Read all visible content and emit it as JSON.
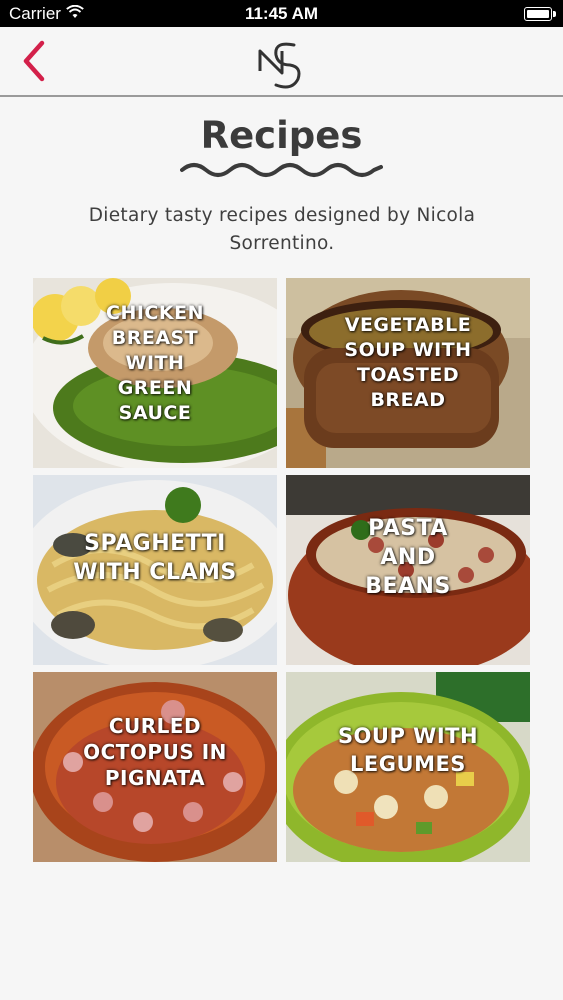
{
  "status_bar": {
    "carrier": "Carrier",
    "time": "11:45 AM"
  },
  "page": {
    "title": "Recipes",
    "subtitle": "Dietary tasty recipes designed by Nicola Sorrentino."
  },
  "recipes": [
    {
      "name": "CHICKEN BREAST WITH GREEN SAUCE"
    },
    {
      "name": "VEGETABLE SOUP WITH TOASTED BREAD"
    },
    {
      "name": "SPAGHETTI WITH CLAMS"
    },
    {
      "name": "PASTA AND BEANS"
    },
    {
      "name": "CURLED OCTOPUS IN PIGNATA"
    },
    {
      "name": "SOUP WITH LEGUMES"
    }
  ],
  "colors": {
    "accent": "#d3204a",
    "text": "#3b3b3b",
    "background": "#f6f6f6"
  }
}
